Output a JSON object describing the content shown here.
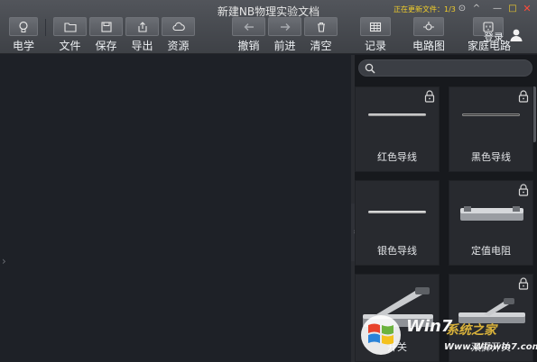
{
  "window": {
    "title": "新建NB物理实验文档",
    "update_status": "正在更新文件：1/3",
    "controls": {
      "settings": "⊙",
      "minimize": "—",
      "collapse": "^",
      "maximize": "□",
      "close": "✕"
    }
  },
  "toolbar": {
    "physics": "电学",
    "file": "文件",
    "save": "保存",
    "export": "导出",
    "resources": "资源",
    "undo": "撤销",
    "redo": "前进",
    "clear": "清空",
    "record": "记录",
    "circuit_diagram": "电路图",
    "home_circuit": "家庭电路",
    "login": "登录"
  },
  "canvas": {
    "left_arrow": "›",
    "collapse_arrow": "›"
  },
  "panel": {
    "search_placeholder": "",
    "components": [
      {
        "label": "红色导线",
        "locked": true
      },
      {
        "label": "黑色导线",
        "locked": true
      },
      {
        "label": "银色导线",
        "locked": false
      },
      {
        "label": "定值电阻",
        "locked": true
      },
      {
        "label": "开关",
        "locked": false
      },
      {
        "label": "双掷开关",
        "locked": true
      }
    ]
  },
  "watermark": {
    "brand": "Win7",
    "brand_sub": "系统之家",
    "url": "Www.Winwin7.com"
  },
  "colors": {
    "accent_yellow": "#f3cf2a",
    "close_red": "#ff4b3a",
    "canvas_bg": "#1e2127",
    "panel_bg": "#17191d"
  }
}
